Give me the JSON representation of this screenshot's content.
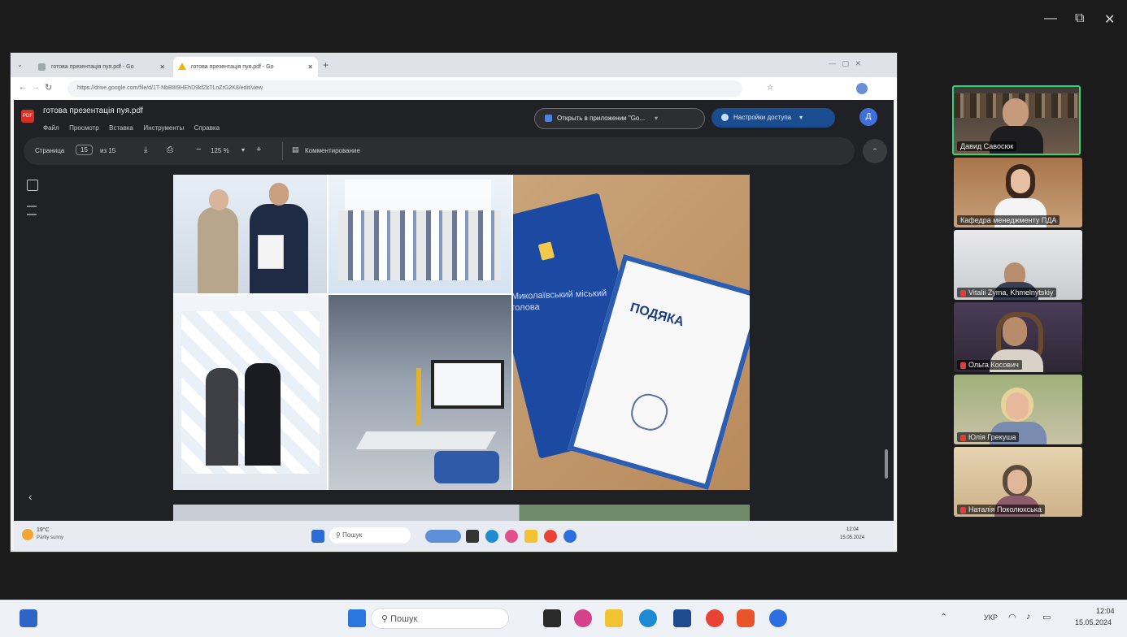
{
  "meeting": {
    "controls": {
      "minimize": "—",
      "restore": "⧉",
      "close": "✕"
    }
  },
  "browser": {
    "tabs": [
      {
        "label": "готова презентація пуя.pdf - Go",
        "active": false
      },
      {
        "label": "готова презентація пуя.pdf - Go",
        "active": true
      }
    ],
    "new_tab": "+",
    "url": "https://drive.google.com/file/d/1T-NbB8I9HEhD9kfZkTLnZrG2K8/edit/view"
  },
  "pdf_viewer": {
    "file_name": "готова презентація пуя.pdf",
    "menu": [
      "Файл",
      "Просмотр",
      "Вставка",
      "Инструменты",
      "Справка"
    ],
    "open_in_app": "Открыть в приложении \"Go...",
    "share": "Настройки доступа",
    "account_initial": "Д",
    "page_label": "Страница",
    "page_current": "15",
    "page_of": "из 15",
    "zoom": "125 %",
    "comment": "Комментирование"
  },
  "slide": {
    "seal_text": "Миколаївський міський голова",
    "certificate_title": "ПОДЯКА"
  },
  "inner_taskbar": {
    "weather_temp": "19°C",
    "weather_desc": "Partly sunny",
    "search": "Пошук",
    "time": "12:04",
    "date": "15.05.2024"
  },
  "participants": [
    {
      "name": "Давид Савосюк",
      "muted": false,
      "active": true
    },
    {
      "name": "Кафедра менеджменту ПДА",
      "muted": false,
      "active": false
    },
    {
      "name": "Vitalii Zyma, Khmelnytskiy",
      "muted": true,
      "active": false
    },
    {
      "name": "Ольга Косович",
      "muted": true,
      "active": false
    },
    {
      "name": "Юлія Грекуша",
      "muted": true,
      "active": false
    },
    {
      "name": "Наталія Поколюхська",
      "muted": true,
      "active": false
    }
  ],
  "os_taskbar": {
    "search": "Пошук",
    "lang": "УКР",
    "time": "12:04",
    "date": "15.05.2024"
  }
}
